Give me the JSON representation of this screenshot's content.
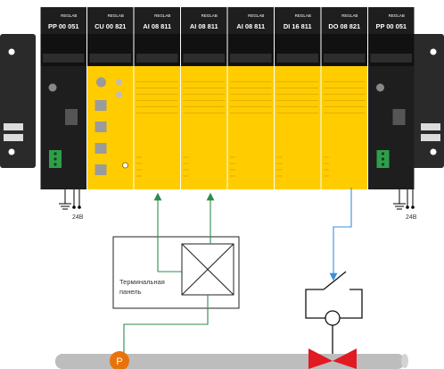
{
  "brand": "REGLAB",
  "modules": [
    {
      "id": "PP 00 051",
      "kind": "power"
    },
    {
      "id": "CU 00 821",
      "kind": "cpu"
    },
    {
      "id": "AI 08 811",
      "kind": "io"
    },
    {
      "id": "AI 08 811",
      "kind": "io"
    },
    {
      "id": "AI 08 811",
      "kind": "io"
    },
    {
      "id": "DI 16 811",
      "kind": "io"
    },
    {
      "id": "DO 08 821",
      "kind": "io"
    },
    {
      "id": "PP 00 051",
      "kind": "power"
    }
  ],
  "supply": {
    "left_label": "24В",
    "right_label": "24В"
  },
  "terminal_panel": {
    "line1": "Терминальная",
    "line2": "панель"
  },
  "sensor": {
    "letter": "P"
  },
  "colors": {
    "module_yellow": "#ffcc00",
    "module_black": "#1e1e1e",
    "panel_dark": "#2a2a2a",
    "signal_green": "#2e8b4a",
    "signal_blue": "#3a8fd9",
    "connector_green": "#2f9e4a",
    "pipe_gray": "#bdbdbd",
    "sensor_orange": "#e8730c",
    "valve_red": "#e11b22"
  }
}
